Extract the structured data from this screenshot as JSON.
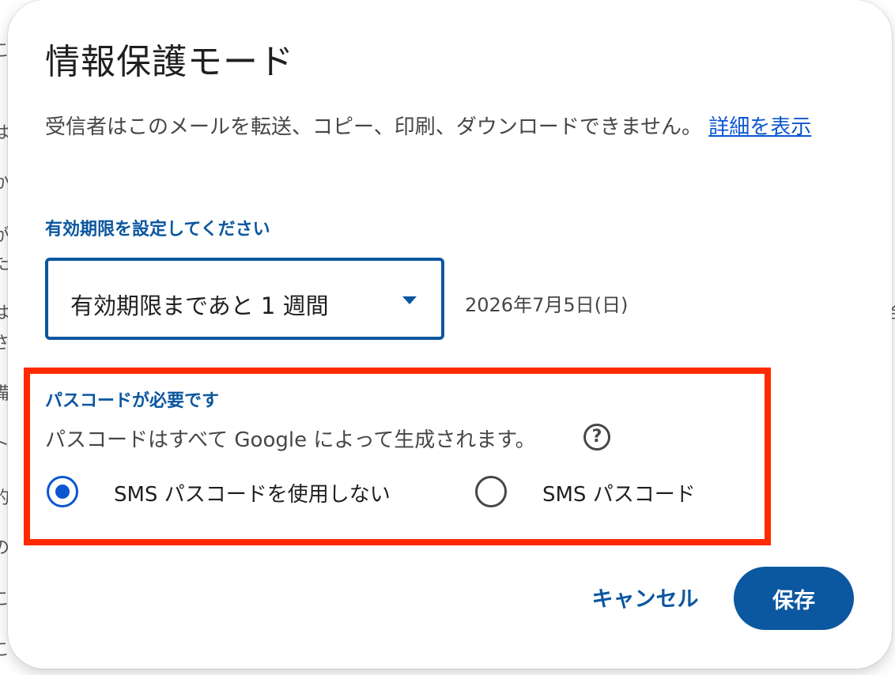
{
  "background": {
    "left_fragments": [
      "こ",
      "は",
      "か",
      "が",
      "た",
      "は",
      "さ",
      "備",
      "ト",
      "的",
      "の",
      "こ",
      "こ"
    ],
    "right_fragments": [
      "合"
    ]
  },
  "dialog": {
    "title": "情報保護モード",
    "description": "受信者はこのメールを転送、コピー、印刷、ダウンロードできません。",
    "details_link": "詳細を表示",
    "expiry": {
      "label": "有効期限を設定してください",
      "selected": "有効期限まであと 1 週間",
      "date": "2026年7月5日(日)"
    },
    "passcode": {
      "label": "パスコードが必要です",
      "description": "パスコードはすべて Google によって生成されます。",
      "help_icon": "?",
      "options": [
        {
          "label": "SMS パスコードを使用しない",
          "selected": true
        },
        {
          "label": "SMS パスコード",
          "selected": false
        }
      ]
    },
    "buttons": {
      "cancel": "キャンセル",
      "save": "保存"
    }
  },
  "colors": {
    "accent": "#0b57a0",
    "link": "#0b57d0",
    "highlight": "#ff2a00"
  }
}
